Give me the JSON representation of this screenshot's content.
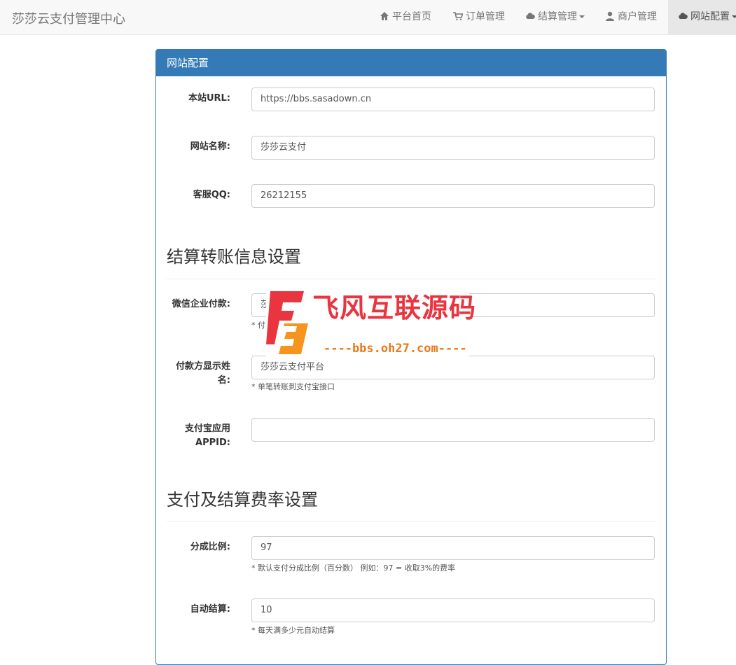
{
  "navbar": {
    "brand": "莎莎云支付管理中心",
    "items": [
      {
        "label": "平台首页",
        "icon": "home-icon"
      },
      {
        "label": "订单管理",
        "icon": "cart-icon"
      },
      {
        "label": "结算管理",
        "icon": "cloud-icon",
        "dropdown": true
      },
      {
        "label": "商户管理",
        "icon": "user-icon"
      },
      {
        "label": "网站配置",
        "icon": "cloud-icon",
        "dropdown": true,
        "active": true
      }
    ]
  },
  "panel": {
    "title": "网站配置",
    "fields": {
      "site_url": {
        "label": "本站URL:",
        "value": "https://bbs.sasadown.cn"
      },
      "site_name": {
        "label": "网站名称:",
        "value": "莎莎云支付"
      },
      "service_qq": {
        "label": "客服QQ:",
        "value": "26212155"
      }
    },
    "section_transfer": {
      "title": "结算转账信息设置",
      "fields": {
        "wechat_pay": {
          "label": "微信企业付款:",
          "value": "莎",
          "help": "* 付"
        },
        "payer_name": {
          "label_line1": "付款方显示姓",
          "label_line2": "名:",
          "value": "莎莎云支付平台",
          "help": "* 单笔转账到支付宝接口"
        },
        "alipay_appid": {
          "label_line1": "支付宝应用",
          "label_line2": "APPID:",
          "value": ""
        }
      }
    },
    "section_rate": {
      "title": "支付及结算费率设置",
      "fields": {
        "split_ratio": {
          "label": "分成比例:",
          "value": "97",
          "help": "* 默认支付分成比例（百分数） 例如：97 = 收取3%的费率"
        },
        "auto_settle": {
          "label": "自动结算:",
          "value": "10",
          "help": "* 每天满多少元自动结算"
        }
      }
    }
  },
  "watermark": {
    "title": "飞风互联源码",
    "url": "----bbs.oh27.com----",
    "colors": {
      "red": "#e8353f",
      "orange": "#f7941d"
    }
  },
  "colors": {
    "primary": "#337ab7",
    "navbar_bg": "#f8f8f8"
  }
}
